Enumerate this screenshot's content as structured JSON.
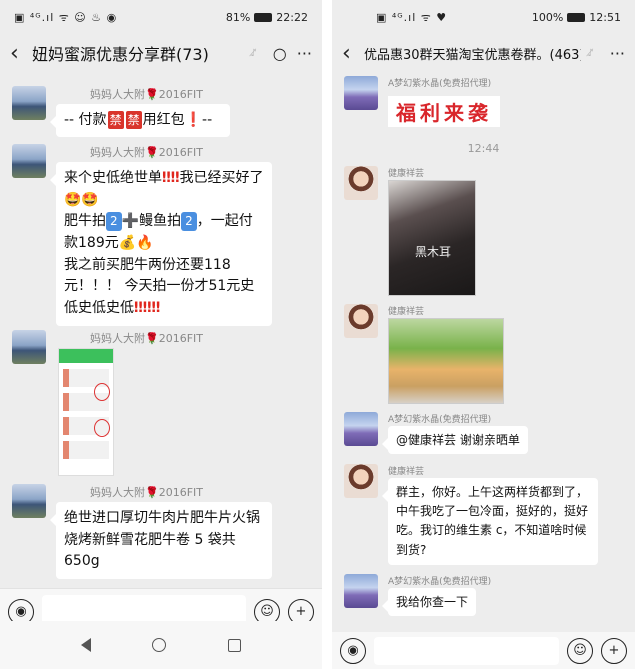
{
  "left": {
    "status": {
      "left": "▣ ⁴ᴳ.ıl ᯤ ☺ ♨ ◉",
      "battery": "81%",
      "time": "22:22",
      "mute": "♪̸"
    },
    "title": "妞妈蜜源优惠分享群(73)",
    "messages": [
      {
        "sender": "妈妈人大附🌹2016FIT"
      },
      {
        "sender": "妈妈人大附🌹2016FIT"
      },
      {
        "sender": "妈妈人大附🌹2016FIT"
      },
      {
        "sender": "妈妈人大附🌹2016FIT"
      }
    ],
    "msg1": {
      "pre": "-- 付款",
      "b1": "禁",
      "b2": "禁",
      "mid": "用红包",
      "mark": "❗",
      "post": "--"
    },
    "msg2": {
      "line1a": "来个史低绝世单",
      "mark": "‼‼",
      "line1b": "我已经买好了🤩🤩",
      "line2a": "肥牛拍",
      "n1": "2",
      "plus": "➕",
      "line2b": "鳗鱼拍",
      "n2": "2",
      "line2c": "，一起付款189元💰🔥",
      "line3": "我之前买肥牛两份还要118元！！！ 今天拍一份才51元史低史低史低",
      "mark2": "‼‼‼"
    },
    "msg4": "绝世进口厚切牛肉片肥牛片火锅烧烤新鲜雪花肥牛卷 5 袋共650g"
  },
  "right": {
    "status": {
      "left": "▣ ⁴ᴳ.ıl ᯤ ♥",
      "battery": "100%",
      "time": "12:51",
      "mute": "♪̸"
    },
    "title": "优品惠30群天猫淘宝优惠卷群。(463)",
    "promo_text": "福利来袭",
    "timestamp": "12:44",
    "photo_label": "黑木耳",
    "messages": [
      {
        "sender": "A梦幻紫水晶(免费招代理)"
      },
      {
        "sender": "健康祥芸"
      },
      {
        "sender": "健康祥芸"
      },
      {
        "sender": "A梦幻紫水晶(免费招代理)",
        "text": "@健康祥芸  谢谢亲晒单"
      },
      {
        "sender": "健康祥芸",
        "text": "群主，你好。上午这两样货都到了，中午我吃了一包冷面，挺好的，挺好吃。我订的维生素 c，不知道啥时候到货?"
      },
      {
        "sender": "A梦幻紫水晶(免费招代理)",
        "text": "我给你查一下"
      }
    ]
  },
  "icons": {
    "back": "‹",
    "more": "···",
    "search": "○",
    "voice": "◉",
    "emoji": "☺",
    "plus": "+"
  }
}
